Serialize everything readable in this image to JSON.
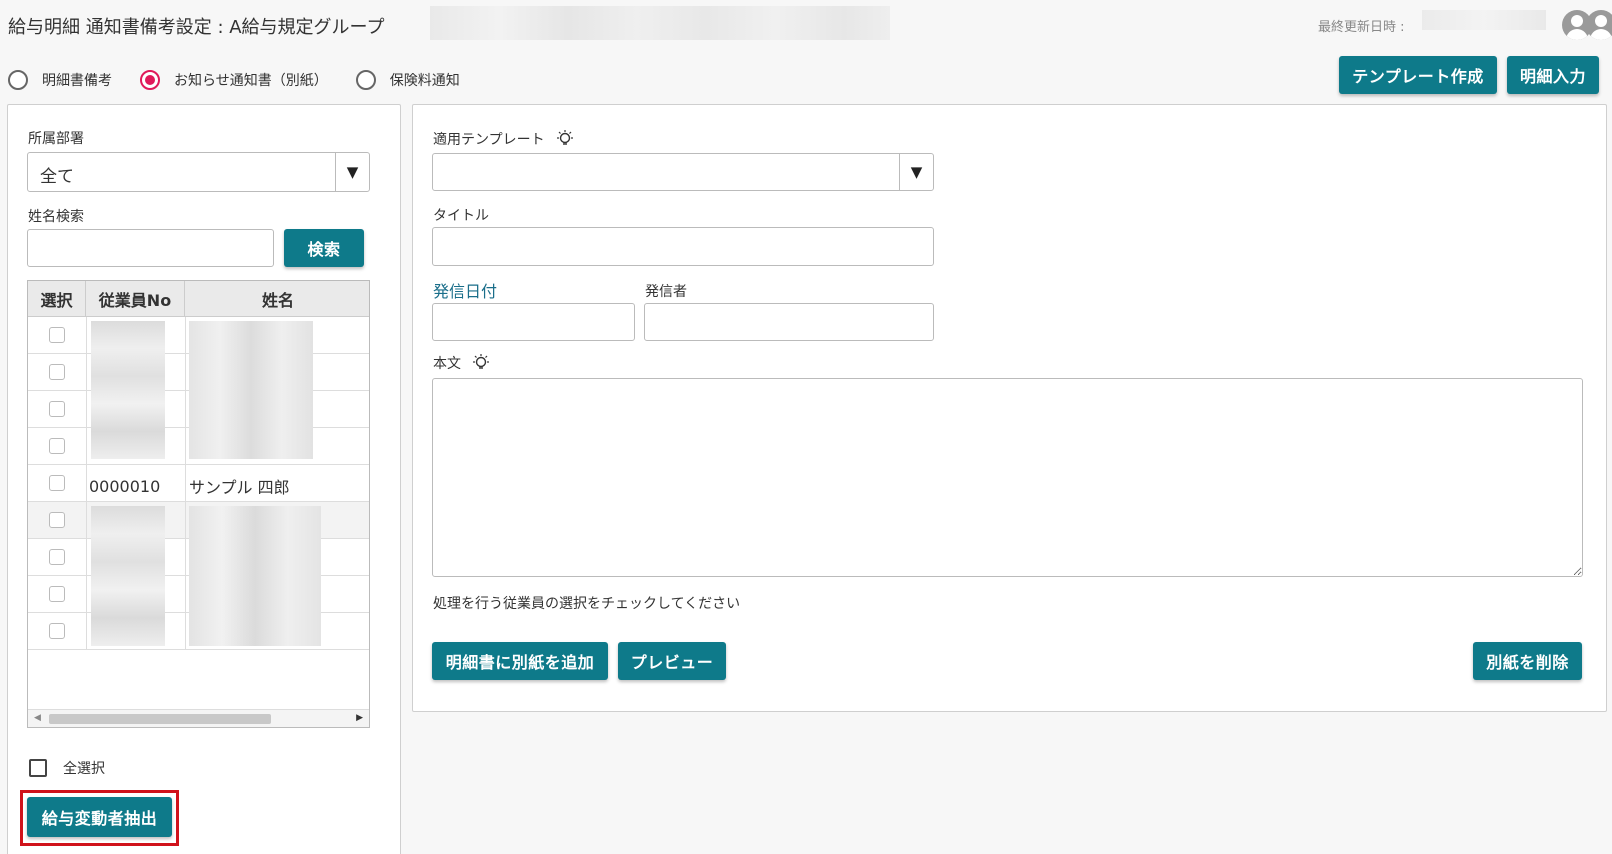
{
  "header": {
    "title": "給与明細 通知書備考設定 : A給与規定グループ",
    "last_updated_label": "最終更新日時 :"
  },
  "radios": [
    {
      "label": "明細書備考",
      "selected": false
    },
    {
      "label": "お知らせ通知書（別紙）",
      "selected": true
    },
    {
      "label": "保険料通知",
      "selected": false
    }
  ],
  "toolbar": {
    "template_button": "テンプレート作成",
    "detail_input_button": "明細入力"
  },
  "left": {
    "department_label": "所属部署",
    "department_value": "全て",
    "name_search_label": "姓名検索",
    "name_search_value": "",
    "search_button": "検索",
    "columns": [
      "選択",
      "従業員No",
      "姓名"
    ],
    "visible_row": {
      "employee_no": "0000010",
      "name": "サンプル 四郎"
    },
    "select_all_label": "全選択",
    "extract_button": "給与変動者抽出"
  },
  "right": {
    "template_label": "適用テンプレート",
    "template_value": "",
    "title_label": "タイトル",
    "title_value": "",
    "date_label": "発信日付",
    "date_value": "",
    "sender_label": "発信者",
    "sender_value": "",
    "body_label": "本文",
    "body_value": "",
    "instruction": "処理を行う従業員の選択をチェックしてください",
    "add_button": "明細書に別紙を追加",
    "preview_button": "プレビュー",
    "delete_button": "別紙を削除"
  },
  "colors": {
    "accent": "#0e7a8a",
    "radio_selected": "#e0195a",
    "highlight_outline": "#d0121b",
    "date_label": "#1a6e8a"
  }
}
